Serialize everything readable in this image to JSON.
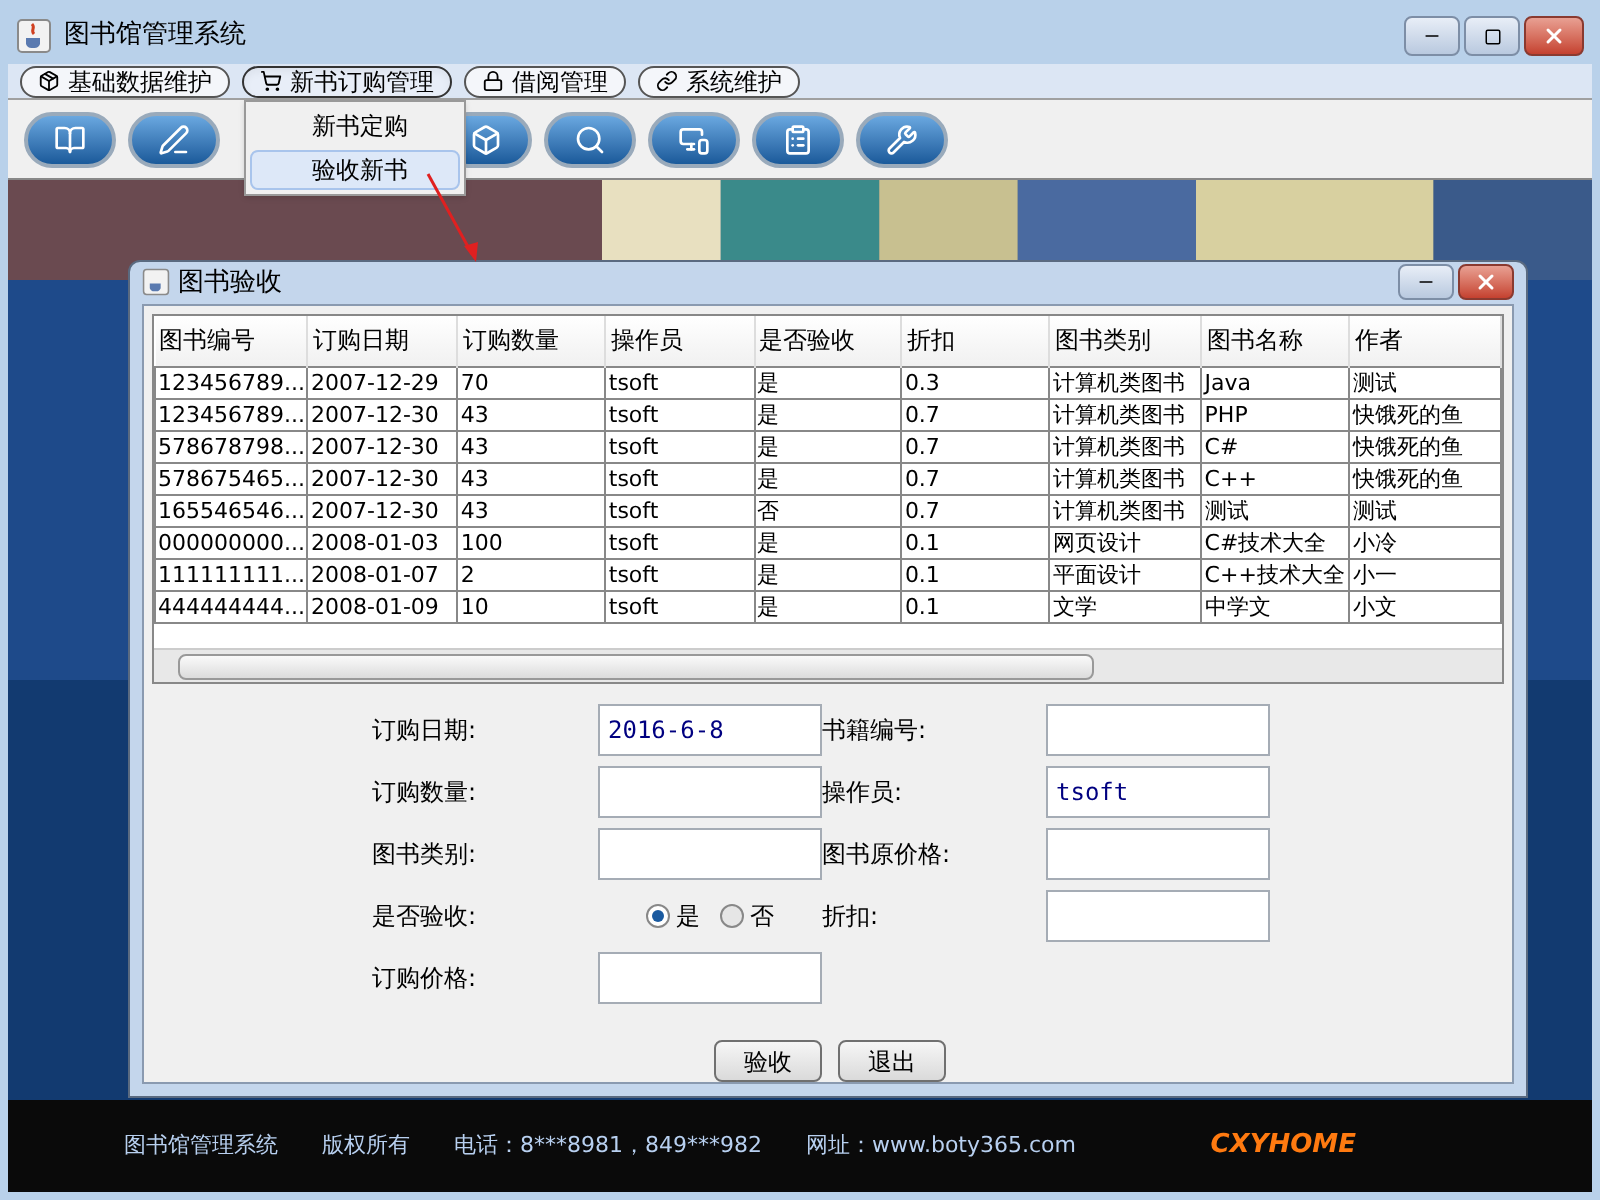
{
  "window": {
    "title": "图书馆管理系统"
  },
  "menus": [
    {
      "label": "基础数据维护",
      "selected": false
    },
    {
      "label": "新书订购管理",
      "selected": true
    },
    {
      "label": "借阅管理",
      "selected": false
    },
    {
      "label": "系统维护",
      "selected": false
    }
  ],
  "dropdown": {
    "items": [
      {
        "label": "新书定购",
        "selected": false
      },
      {
        "label": "验收新书",
        "selected": true
      }
    ]
  },
  "dialog": {
    "title": "图书验收",
    "table": {
      "columns": [
        "图书编号",
        "订购日期",
        "订购数量",
        "操作员",
        "是否验收",
        "折扣",
        "图书类别",
        "图书名称",
        "作者"
      ],
      "rows": [
        [
          "123456789...",
          "2007-12-29",
          "70",
          "tsoft",
          "是",
          "0.3",
          "计算机类图书",
          "Java",
          "测试"
        ],
        [
          "123456789...",
          "2007-12-30",
          "43",
          "tsoft",
          "是",
          "0.7",
          "计算机类图书",
          "PHP",
          "快饿死的鱼"
        ],
        [
          "578678798...",
          "2007-12-30",
          "43",
          "tsoft",
          "是",
          "0.7",
          "计算机类图书",
          "C#",
          "快饿死的鱼"
        ],
        [
          "578675465...",
          "2007-12-30",
          "43",
          "tsoft",
          "是",
          "0.7",
          "计算机类图书",
          "C++",
          "快饿死的鱼"
        ],
        [
          "165546546...",
          "2007-12-30",
          "43",
          "tsoft",
          "否",
          "0.7",
          "计算机类图书",
          "测试",
          "测试"
        ],
        [
          "000000000...",
          "2008-01-03",
          "100",
          "tsoft",
          "是",
          "0.1",
          "网页设计",
          "C#技术大全",
          "小冷"
        ],
        [
          "111111111...",
          "2008-01-07",
          "2",
          "tsoft",
          "是",
          "0.1",
          "平面设计",
          "C++技术大全",
          "小一"
        ],
        [
          "444444444...",
          "2008-01-09",
          "10",
          "tsoft",
          "是",
          "0.1",
          "文学",
          "中学文",
          "小文"
        ]
      ]
    },
    "form": {
      "rows": [
        {
          "left": {
            "label": "订购日期:",
            "kind": "text",
            "value": "2016-6-8"
          },
          "right": {
            "label": "书籍编号:"
          }
        },
        {
          "left": {
            "label": "订购数量:",
            "kind": "text"
          },
          "right": {
            "label": "操作员:",
            "value": "tsoft"
          }
        },
        {
          "left": {
            "label": "图书类别:",
            "kind": "text"
          },
          "right": {
            "label": "图书原价格:"
          }
        },
        {
          "left": {
            "label": "是否验收:",
            "kind": "radio",
            "options": [
              {
                "label": "是",
                "selected": true
              },
              {
                "label": "否",
                "selected": false
              }
            ]
          },
          "right": {
            "label": "折扣:"
          }
        },
        {
          "left": {
            "label": "订购价格:",
            "kind": "text"
          }
        }
      ]
    },
    "buttons": [
      "验收",
      "退出"
    ]
  },
  "footer": {
    "texts": [
      "图书馆管理系统",
      "版权所有",
      "电话：8***8981，849***982",
      "网址：www.boty365.com"
    ],
    "logo": "CXYHOME"
  }
}
